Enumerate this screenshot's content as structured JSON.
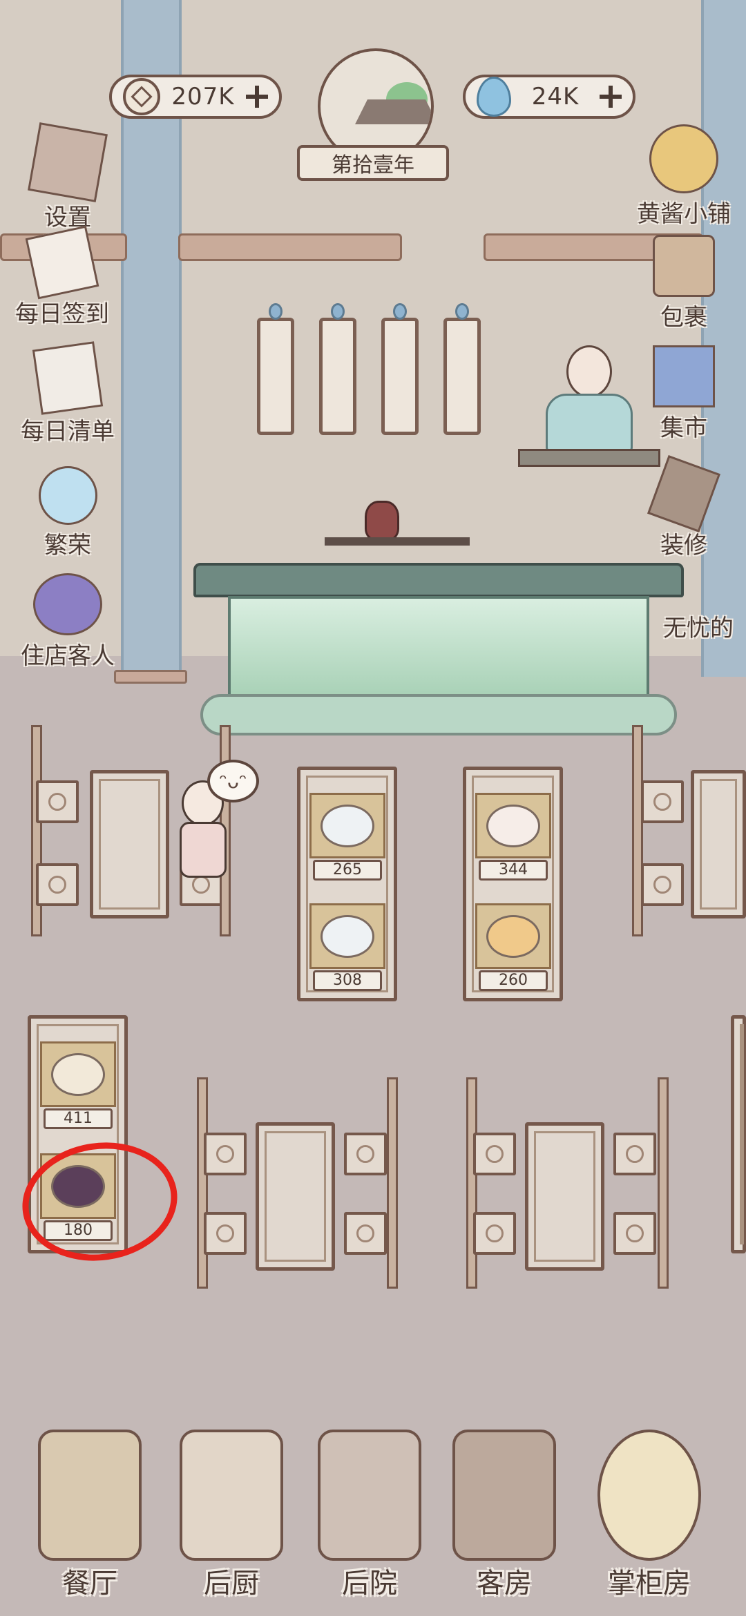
{
  "currency": {
    "coins": "207K",
    "jade": "24K"
  },
  "year": "第拾壹年",
  "left_menu": [
    {
      "label": "设置",
      "icon": "settings-box-icon"
    },
    {
      "label": "每日签到",
      "icon": "sign-in-icon"
    },
    {
      "label": "每日清单",
      "icon": "checklist-icon"
    },
    {
      "label": "繁荣",
      "icon": "prosperity-icon"
    },
    {
      "label": "住店客人",
      "icon": "guest-icon"
    }
  ],
  "right_menu": [
    {
      "label": "黄酱小铺",
      "icon": "shop-icon"
    },
    {
      "label": "包裹",
      "icon": "bag-icon"
    },
    {
      "label": "集市",
      "icon": "market-icon"
    },
    {
      "label": "装修",
      "icon": "decorate-icon"
    },
    {
      "label": "无忧的",
      "icon": "event-icon"
    }
  ],
  "dishes": [
    {
      "price": "265"
    },
    {
      "price": "308"
    },
    {
      "price": "344"
    },
    {
      "price": "260"
    },
    {
      "price": "411"
    },
    {
      "price": "180"
    }
  ],
  "customer_emote": "ᵔᴗᵔ",
  "bottom_nav": [
    {
      "label": "餐厅"
    },
    {
      "label": "后厨"
    },
    {
      "label": "后院"
    },
    {
      "label": "客房"
    },
    {
      "label": "掌柜房"
    }
  ],
  "colors": {
    "wall": "#d6cdc3",
    "floor": "#c4b9b7",
    "pillar": "#a9bccb",
    "outline": "#6e5348",
    "highlight": "#e8231c"
  }
}
